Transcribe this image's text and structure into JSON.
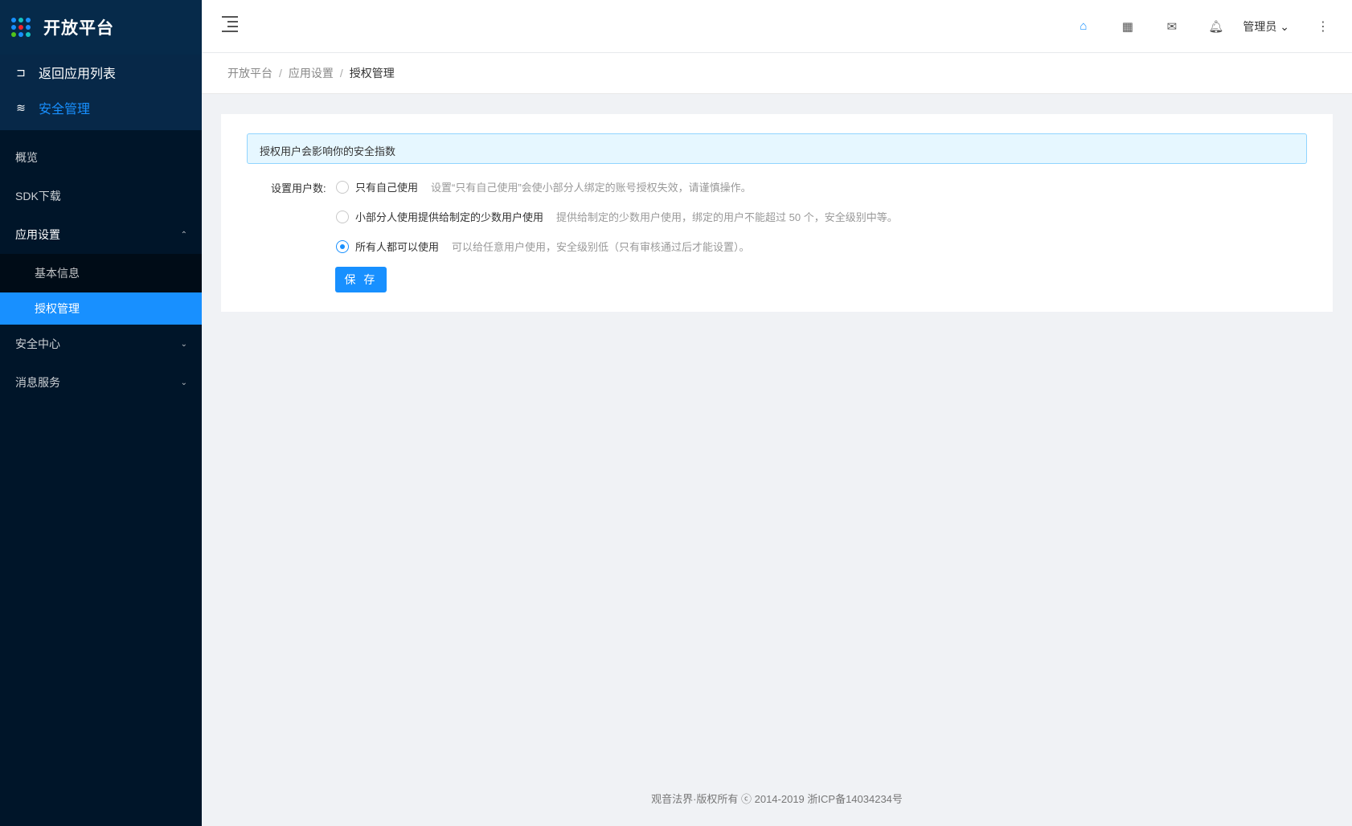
{
  "sidebar": {
    "brand": "开放平台",
    "back_link": "返回应用列表",
    "security_link": "安全管理",
    "menu": [
      {
        "label": "概览"
      },
      {
        "label": "SDK下载"
      },
      {
        "label": "应用设置",
        "children": [
          "基本信息",
          "授权管理"
        ]
      },
      {
        "label": "安全中心"
      },
      {
        "label": "消息服务"
      }
    ]
  },
  "header": {
    "user": "管理员",
    "icons": [
      "home-icon",
      "apps-icon",
      "mail-icon",
      "bell-icon",
      "more-icon"
    ]
  },
  "breadcrumb": [
    "开放平台",
    "应用设置",
    "授权管理"
  ],
  "alert": "授权用户会影响你的安全指数",
  "form": {
    "label": "设置用户数:",
    "options": [
      {
        "label": "只有自己使用",
        "desc": "设置“只有自己使用”会使小部分人绑定的账号授权失效，请谨慎操作。",
        "checked": false
      },
      {
        "label": "小部分人使用提供给制定的少数用户使用",
        "desc": "提供给制定的少数用户使用，绑定的用户不能超过 50 个，安全级别中等。",
        "checked": false
      },
      {
        "label": "所有人都可以使用",
        "desc": "可以给任意用户使用，安全级别低（只有审核通过后才能设置）。",
        "checked": true
      }
    ],
    "save": "保 存"
  },
  "footer": "观音法界·版权所有 ⓒ 2014-2019 浙ICP备14034234号",
  "colors": {
    "primary": "#1890ff",
    "sidebar": "#001529"
  }
}
